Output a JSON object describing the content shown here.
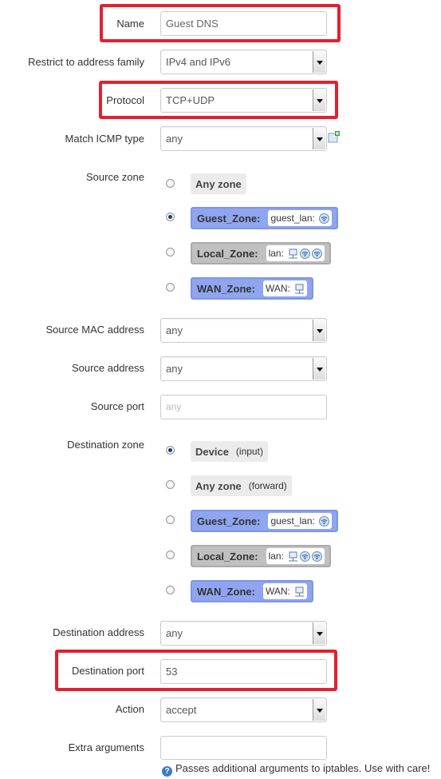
{
  "name": {
    "label": "Name",
    "value": "Guest DNS"
  },
  "family": {
    "label": "Restrict to address family",
    "value": "IPv4 and IPv6"
  },
  "protocol": {
    "label": "Protocol",
    "value": "TCP+UDP"
  },
  "icmp": {
    "label": "Match ICMP type",
    "value": "any"
  },
  "source_zone": {
    "label": "Source zone",
    "options": [
      {
        "zone": "Any zone",
        "selected": false
      },
      {
        "zone": "Guest_Zone:",
        "net": "guest_lan:",
        "selected": true
      },
      {
        "zone": "Local_Zone:",
        "net": "lan:",
        "selected": false
      },
      {
        "zone": "WAN_Zone:",
        "net": "WAN:",
        "selected": false
      }
    ]
  },
  "src_mac": {
    "label": "Source MAC address",
    "value": "any"
  },
  "src_addr": {
    "label": "Source address",
    "value": "any"
  },
  "src_port": {
    "label": "Source port",
    "placeholder": "any"
  },
  "dest_zone": {
    "label": "Destination zone",
    "options": [
      {
        "zone": "Device",
        "note": "(input)",
        "selected": true
      },
      {
        "zone": "Any zone",
        "note": "(forward)",
        "selected": false
      },
      {
        "zone": "Guest_Zone:",
        "net": "guest_lan:",
        "selected": false
      },
      {
        "zone": "Local_Zone:",
        "net": "lan:",
        "selected": false
      },
      {
        "zone": "WAN_Zone:",
        "net": "WAN:",
        "selected": false
      }
    ]
  },
  "dest_addr": {
    "label": "Destination address",
    "value": "any"
  },
  "dest_port": {
    "label": "Destination port",
    "value": "53"
  },
  "action": {
    "label": "Action",
    "value": "accept"
  },
  "extra": {
    "label": "Extra arguments",
    "value": "",
    "hint": "Passes additional arguments to iptables. Use with care!"
  },
  "colors": {
    "highlight": "#e3202f",
    "zone_blue": "#90a5f0",
    "zone_grey": "#c0c0c0"
  }
}
